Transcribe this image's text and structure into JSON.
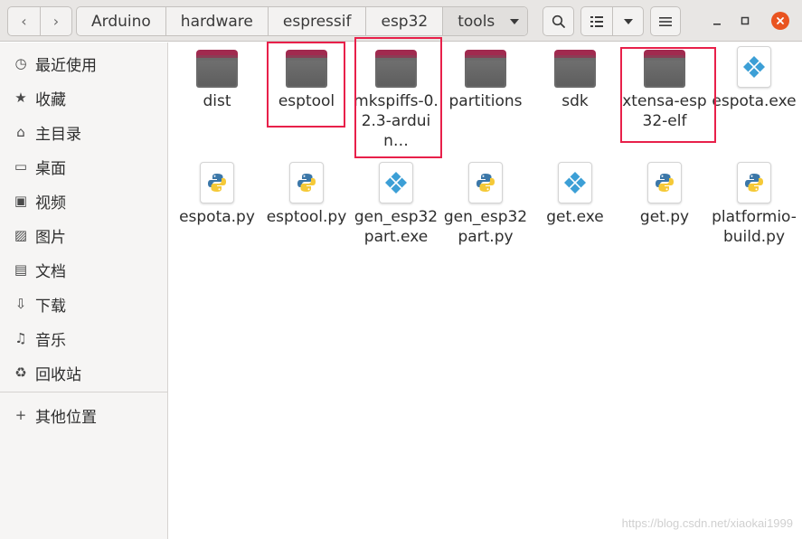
{
  "navigation": {
    "back_icon": "‹",
    "forward_icon": "›"
  },
  "breadcrumbs": [
    "Arduino",
    "hardware",
    "espressif",
    "esp32",
    "tools"
  ],
  "sidebar": {
    "items": [
      {
        "label": "最近使用",
        "icon": "recent-icon",
        "glyph": "◷"
      },
      {
        "label": "收藏",
        "icon": "star-icon",
        "glyph": "★"
      },
      {
        "label": "主目录",
        "icon": "home-icon",
        "glyph": "⌂"
      },
      {
        "label": "桌面",
        "icon": "desktop-icon",
        "glyph": "▭"
      },
      {
        "label": "视频",
        "icon": "video-icon",
        "glyph": "▣"
      },
      {
        "label": "图片",
        "icon": "picture-icon",
        "glyph": "▨"
      },
      {
        "label": "文档",
        "icon": "document-icon",
        "glyph": "▤"
      },
      {
        "label": "下载",
        "icon": "download-icon",
        "glyph": "⇩"
      },
      {
        "label": "音乐",
        "icon": "music-icon",
        "glyph": "♫"
      },
      {
        "label": "回收站",
        "icon": "trash-icon",
        "glyph": "♻"
      }
    ],
    "other_locations": {
      "label": "其他位置",
      "icon": "plus-icon",
      "glyph": "+"
    }
  },
  "files": [
    {
      "name": "dist",
      "type": "folder"
    },
    {
      "name": "esptool",
      "type": "folder"
    },
    {
      "name": "mkspiffs-0.2.3-arduin…",
      "type": "folder"
    },
    {
      "name": "partitions",
      "type": "folder"
    },
    {
      "name": "sdk",
      "type": "folder"
    },
    {
      "name": "xtensa-esp32-elf",
      "type": "folder"
    },
    {
      "name": "espota.exe",
      "type": "exe"
    },
    {
      "name": "espota.py",
      "type": "python"
    },
    {
      "name": "esptool.py",
      "type": "python"
    },
    {
      "name": "gen_esp32part.exe",
      "type": "exe"
    },
    {
      "name": "gen_esp32part.py",
      "type": "python"
    },
    {
      "name": "get.exe",
      "type": "exe"
    },
    {
      "name": "get.py",
      "type": "python"
    },
    {
      "name": "platformio-build.py",
      "type": "python"
    }
  ],
  "watermark": "https://blog.csdn.net/xiaokai1999",
  "colors": {
    "close": "#e95420",
    "folder_tab": "#a12a4f",
    "highlight": "#e8204a"
  }
}
